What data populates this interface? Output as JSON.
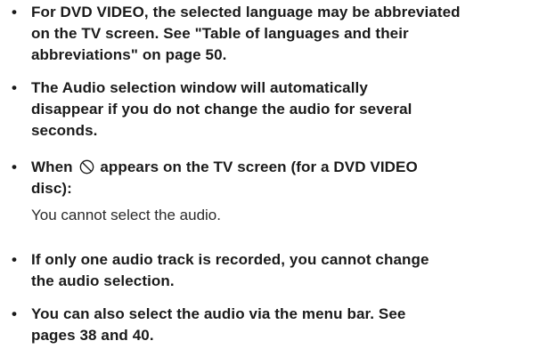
{
  "notes": [
    {
      "lines": [
        "For DVD VIDEO, the selected language may be abbreviated",
        "on the TV screen. See \"Table of languages and their",
        "abbreviations\" on page 50."
      ]
    },
    {
      "lines": [
        "The Audio selection window will automatically",
        "disappear if you do not change the audio for several",
        "seconds."
      ]
    },
    {
      "line1_before_icon": "When",
      "line1_after_icon": "appears on the TV screen (for a DVD VIDEO",
      "line2": "disc):",
      "icon": "prohibit-icon",
      "detail": "You cannot select the audio."
    },
    {
      "lines": [
        "If only one audio track is recorded, you cannot change",
        "the audio selection."
      ]
    },
    {
      "lines": [
        "You can also select the audio via the menu bar. See",
        "pages 38 and 40."
      ]
    }
  ],
  "bullet_glyph": "•"
}
